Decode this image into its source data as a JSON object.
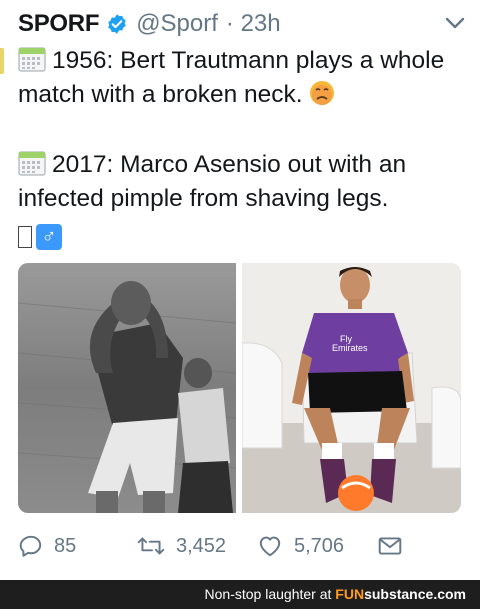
{
  "tweet": {
    "author_name": "SPORF",
    "handle": "@Sporf",
    "time": "· 23h",
    "line1": "1956: Bert Trautmann plays a whole match with a broken neck.",
    "line2": "2017: Marco Asensio out with an infected pimple from shaving legs.",
    "male_sign": "♂",
    "icons": [
      "verified-badge-icon",
      "chevron-down-icon",
      "calendar-icon",
      "nauseated-face-icon",
      "male-sign-icon",
      "reply-icon",
      "retweet-icon",
      "like-icon",
      "direct-message-icon"
    ]
  },
  "actions": {
    "replies": "85",
    "retweets": "3,452",
    "likes": "5,706"
  },
  "footer": {
    "prefix": "Non-stop laughter at ",
    "brand_a": "FUN",
    "brand_b": "substance",
    "brand_c": ".com"
  },
  "colors": {
    "verified": "#1da1f2",
    "muted": "#657786",
    "footer_bg": "#1e1e1e",
    "footer_brand": "#ff9b21"
  }
}
